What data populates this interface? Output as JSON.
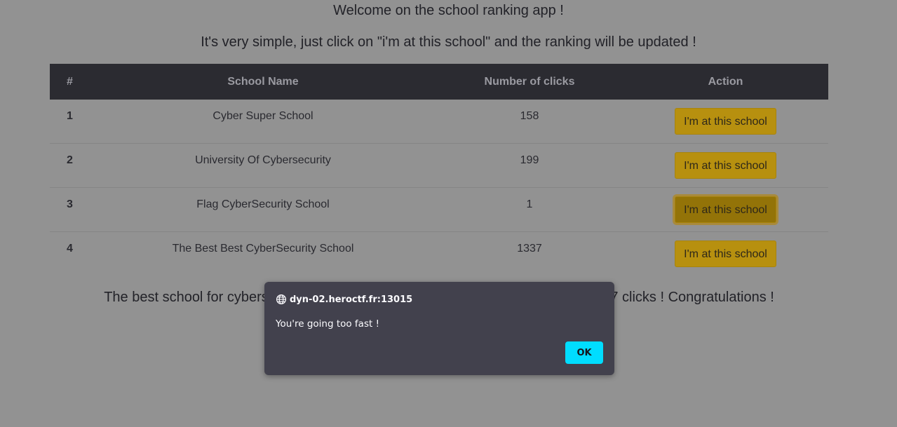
{
  "page": {
    "welcome": "Welcome on the school ranking app !",
    "instructions": "It's very simple, just click on \"i'm at this school\" and the ranking will be updated !",
    "best_school_line": "The best school for cybersecurity is The Best Best CyberSecurity School with 1337 clicks ! Congratulations !"
  },
  "table": {
    "headers": [
      "#",
      "School Name",
      "Number of clicks",
      "Action"
    ],
    "rows": [
      {
        "rank": "1",
        "name": "Cyber Super School",
        "clicks": "158",
        "action": "I'm at this school"
      },
      {
        "rank": "2",
        "name": "University Of Cybersecurity",
        "clicks": "199",
        "action": "I'm at this school"
      },
      {
        "rank": "3",
        "name": "Flag CyberSecurity School",
        "clicks": "1",
        "action": "I'm at this school"
      },
      {
        "rank": "4",
        "name": "The Best Best CyberSecurity School",
        "clicks": "1337",
        "action": "I'm at this school"
      }
    ]
  },
  "dialog": {
    "origin": "dyn-02.heroctf.fr:13015",
    "message": "You're going too fast !",
    "ok_label": "OK",
    "origin_icon": "globe-icon"
  },
  "colors": {
    "overlay_background": "#929292",
    "table_header": "#2b2b31",
    "action_button": "#b7900f",
    "dialog_background": "#42414d",
    "ok_button": "#00ddff"
  }
}
